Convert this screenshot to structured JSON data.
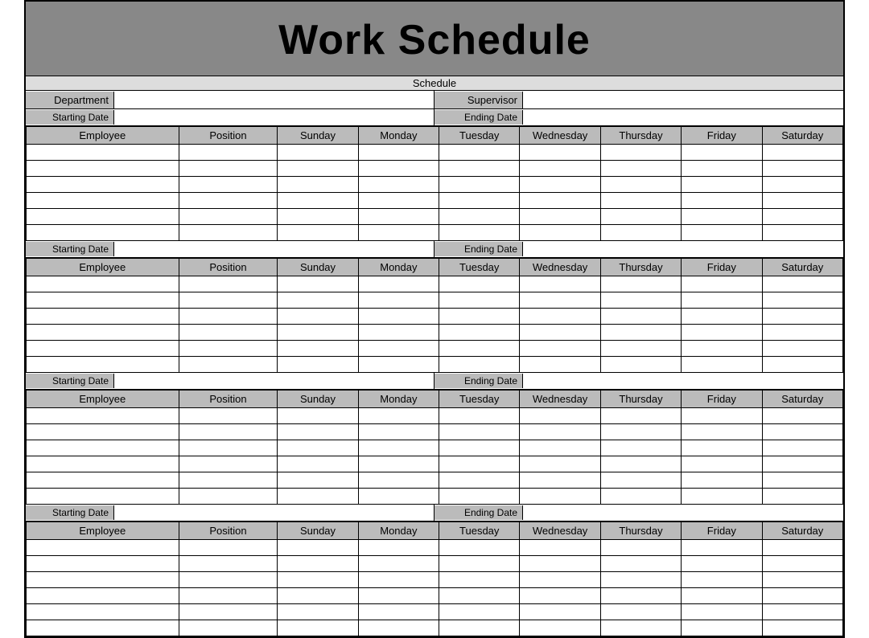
{
  "title": "Work Schedule",
  "schedule_label": "Schedule",
  "fields": {
    "department_label": "Department",
    "supervisor_label": "Supervisor",
    "starting_date_label": "Starting Date",
    "ending_date_label": "Ending Date"
  },
  "columns": [
    "Employee",
    "Position",
    "Sunday",
    "Monday",
    "Tuesday",
    "Wednesday",
    "Thursday",
    "Friday",
    "Saturday"
  ],
  "sections": [
    {
      "id": 1
    },
    {
      "id": 2
    },
    {
      "id": 3
    },
    {
      "id": 4
    }
  ],
  "rows_per_section": 6
}
